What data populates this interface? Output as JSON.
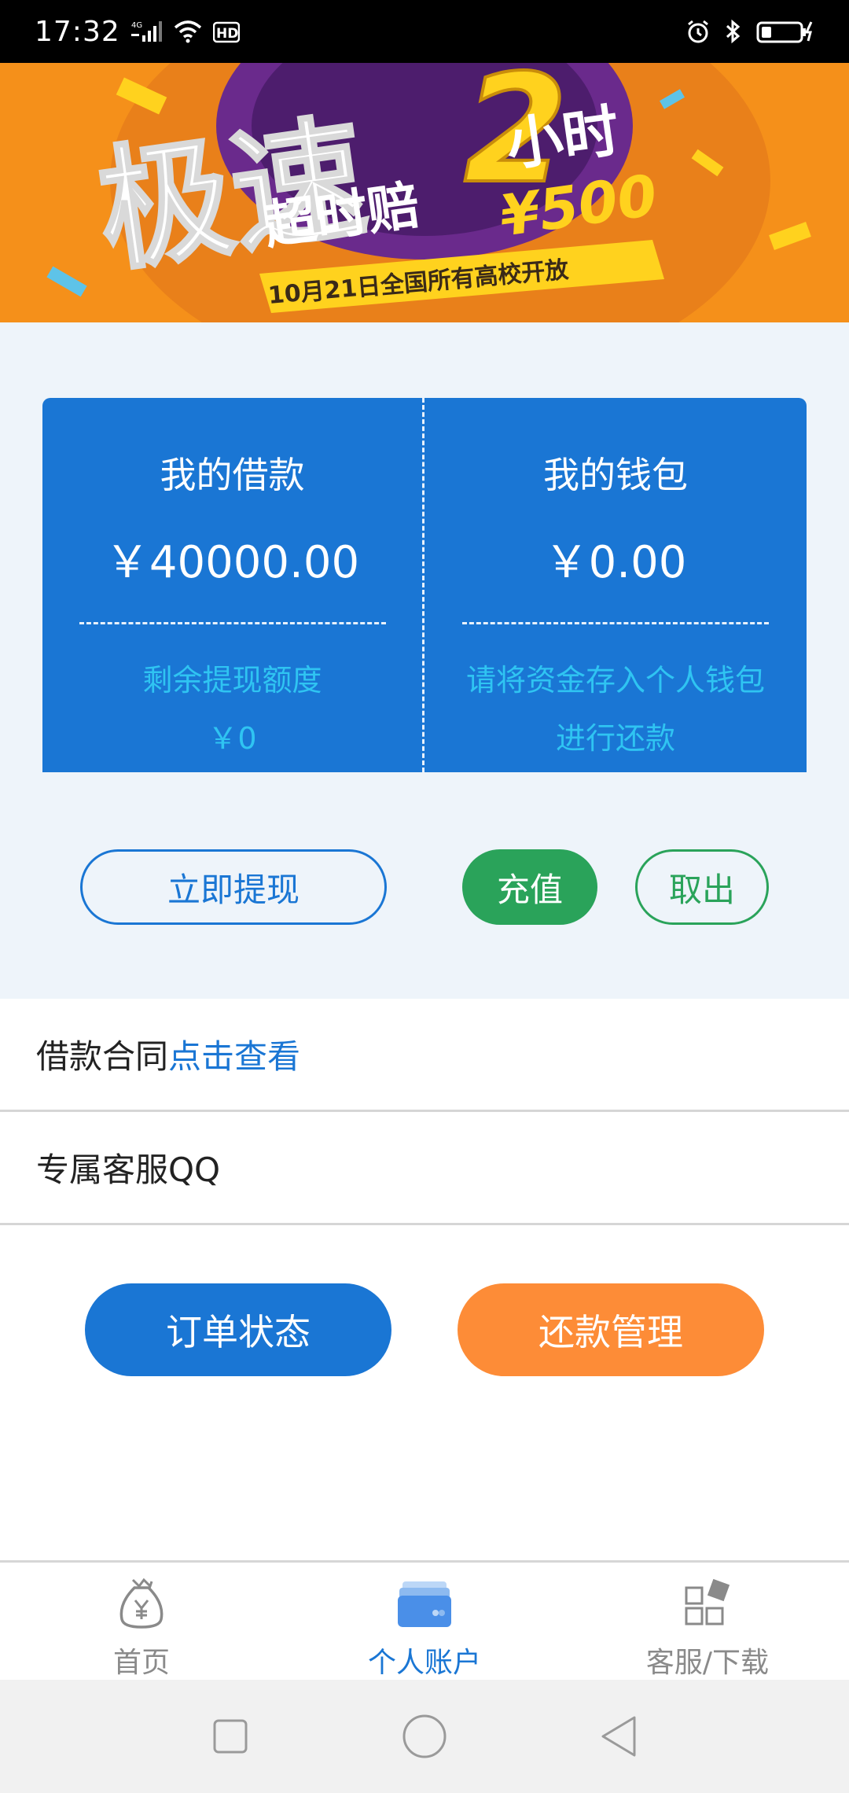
{
  "status_bar": {
    "time": "17:32",
    "network": "4G",
    "hd": "HD"
  },
  "banner": {
    "big_char": "极速",
    "number": "2",
    "hours": "小时",
    "compensation": "超时赔",
    "amount": "¥500",
    "ribbon_text": "10月21日全国所有高校开放",
    "colors": {
      "background": "#f5901a",
      "circle": "#6a2a8c",
      "accent": "#ffd21e"
    }
  },
  "account": {
    "loan": {
      "title": "我的借款",
      "amount": "￥40000.00",
      "note_label": "剩余提现额度",
      "note_value": "￥0"
    },
    "wallet": {
      "title": "我的钱包",
      "amount": "￥0.00",
      "note_line1": "请将资金存入个人钱包",
      "note_line2": "进行还款"
    },
    "buttons": {
      "withdraw": "立即提现",
      "recharge": "充值",
      "takeout": "取出"
    }
  },
  "rows": {
    "contract_label": "借款合同",
    "contract_link": "点击查看",
    "qq_label": "专属客服QQ"
  },
  "actions": {
    "order_status": "订单状态",
    "repay_manage": "还款管理"
  },
  "tabbar": {
    "items": [
      {
        "label": "首页",
        "icon": "money-bag-icon",
        "active": false
      },
      {
        "label": "个人账户",
        "icon": "wallet-icon",
        "active": true
      },
      {
        "label": "客服/下载",
        "icon": "grid-apps-icon",
        "active": false
      }
    ]
  },
  "colors": {
    "primary": "#1a76d4",
    "green": "#2aa35a",
    "orange": "#fd8c37",
    "light_blue_text": "#2fc4f2"
  }
}
